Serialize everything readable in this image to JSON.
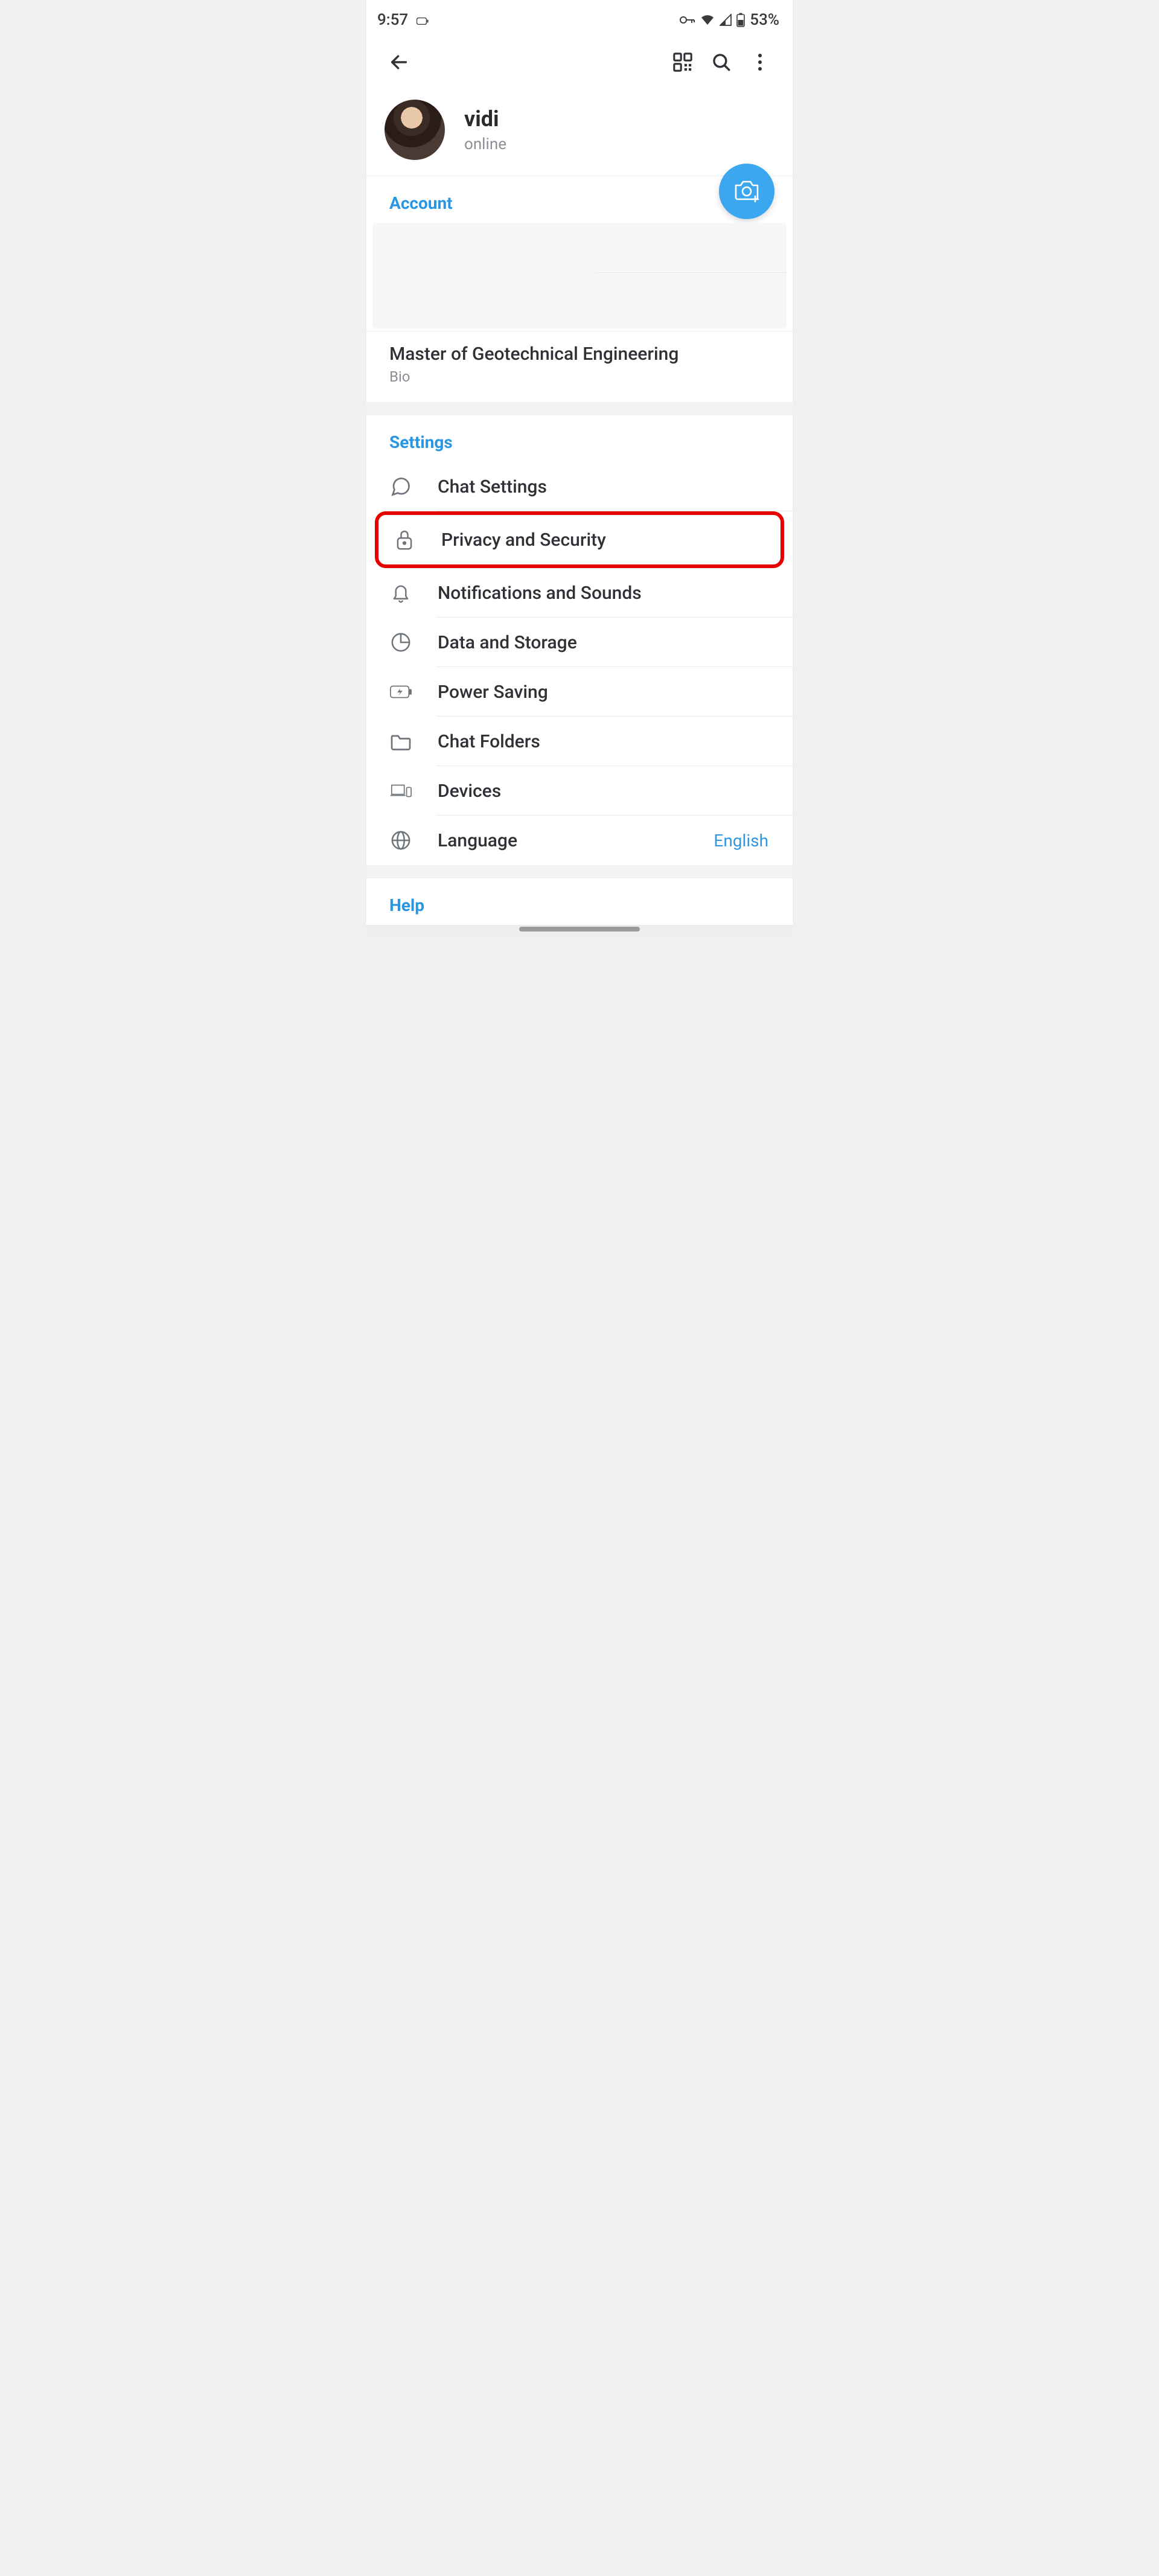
{
  "status": {
    "time": "9:57",
    "battery_text": "53%"
  },
  "profile": {
    "name": "vidi",
    "status": "online"
  },
  "account": {
    "header": "Account",
    "bio_text": "Master of Geotechnical Engineering",
    "bio_label": "Bio"
  },
  "settings": {
    "header": "Settings",
    "items": [
      {
        "label": "Chat Settings"
      },
      {
        "label": "Privacy and Security"
      },
      {
        "label": "Notifications and Sounds"
      },
      {
        "label": "Data and Storage"
      },
      {
        "label": "Power Saving"
      },
      {
        "label": "Chat Folders"
      },
      {
        "label": "Devices"
      },
      {
        "label": "Language",
        "value": "English"
      }
    ]
  },
  "help": {
    "header": "Help"
  }
}
